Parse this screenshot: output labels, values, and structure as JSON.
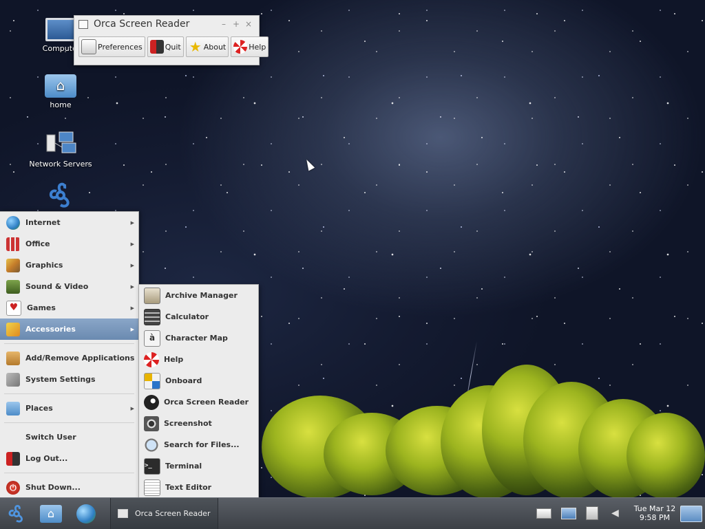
{
  "desktop": {
    "icons": [
      {
        "label": "Computer",
        "icon": "computer-icon"
      },
      {
        "label": "home",
        "icon": "home-folder-icon"
      },
      {
        "label": "Network Servers",
        "icon": "network-servers-icon"
      },
      {
        "label": "",
        "icon": "distro-logo-icon"
      }
    ]
  },
  "orca_window": {
    "title": "Orca Screen Reader",
    "buttons": [
      {
        "label": "Preferences",
        "icon": "preferences-icon"
      },
      {
        "label": "Quit",
        "icon": "quit-icon"
      },
      {
        "label": "About",
        "icon": "star-icon"
      },
      {
        "label": "Help",
        "icon": "lifebuoy-icon"
      }
    ],
    "controls": [
      "minimize",
      "maximize",
      "close"
    ]
  },
  "start_menu": {
    "categories": [
      {
        "label": "Internet",
        "icon": "globe-icon",
        "has_submenu": true
      },
      {
        "label": "Office",
        "icon": "office-icon",
        "has_submenu": true
      },
      {
        "label": "Graphics",
        "icon": "graphics-icon",
        "has_submenu": true
      },
      {
        "label": "Sound & Video",
        "icon": "multimedia-icon",
        "has_submenu": true
      },
      {
        "label": "Games",
        "icon": "cards-icon",
        "has_submenu": true
      },
      {
        "label": "Accessories",
        "icon": "accessories-icon",
        "has_submenu": true,
        "active": true
      }
    ],
    "system": [
      {
        "label": "Add/Remove Applications",
        "icon": "package-icon"
      },
      {
        "label": "System Settings",
        "icon": "tools-icon"
      }
    ],
    "places": {
      "label": "Places",
      "icon": "folder-icon",
      "has_submenu": true
    },
    "session": [
      {
        "label": "Switch User",
        "icon": ""
      },
      {
        "label": "Log Out...",
        "icon": "logout-icon"
      }
    ],
    "shutdown": {
      "label": "Shut Down...",
      "icon": "power-icon"
    }
  },
  "accessories_submenu": {
    "items": [
      {
        "label": "Archive Manager",
        "icon": "archive-icon"
      },
      {
        "label": "Calculator",
        "icon": "calculator-icon"
      },
      {
        "label": "Character Map",
        "icon": "character-map-icon"
      },
      {
        "label": "Help",
        "icon": "lifebuoy-icon"
      },
      {
        "label": "Onboard",
        "icon": "keyboard-icon"
      },
      {
        "label": "Orca Screen Reader",
        "icon": "orca-icon"
      },
      {
        "label": "Screenshot",
        "icon": "camera-icon"
      },
      {
        "label": "Search for Files...",
        "icon": "magnifier-icon"
      },
      {
        "label": "Terminal",
        "icon": "terminal-icon"
      },
      {
        "label": "Text Editor",
        "icon": "text-editor-icon"
      }
    ]
  },
  "taskbar": {
    "launchers": [
      "menu-logo-icon",
      "file-manager-icon",
      "web-browser-icon"
    ],
    "tasks": [
      {
        "label": "Orca Screen Reader",
        "icon": "window-icon"
      }
    ],
    "tray": [
      "mail-icon",
      "network-icon",
      "clipboard-icon",
      "volume-icon"
    ],
    "clock": {
      "day_date": "Tue Mar 12",
      "time": "9:58 PM"
    }
  }
}
